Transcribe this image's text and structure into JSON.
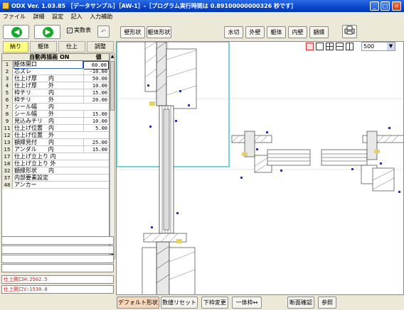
{
  "window": {
    "title": "ODX Ver. 1.03.85 ［データサンプル］［AW-1］-［プログラム実行時間は 0.89100000000326 秒です］",
    "minimize": "_",
    "maximize": "□",
    "close": "×"
  },
  "menu": [
    "ファイル",
    "詳細",
    "設定",
    "記入",
    "入力補助"
  ],
  "toolbar": {
    "back_icon": "arrow-left-icon",
    "forward_icon": "arrow-right-icon",
    "realsize_label": "実数表",
    "realsize_checked": true,
    "undo_icon": "undo-icon",
    "buttons": [
      "壁形状",
      "躯体形状",
      "水切",
      "外壁",
      "躯体",
      "内壁",
      "額縁"
    ],
    "print_icon": "print-icon"
  },
  "tabs": [
    "納り",
    "躯体",
    "仕上",
    "調整"
  ],
  "active_tab": "納り",
  "table": {
    "headers": [
      "自動再描画 ON",
      "値"
    ],
    "rows": [
      {
        "no": "1",
        "name": "躯体開口",
        "value": "60.00"
      },
      {
        "no": "2",
        "name": "芯ズレ",
        "value": "-10.00"
      },
      {
        "no": "3",
        "name": "仕上げ厚　　内",
        "value": "50.00"
      },
      {
        "no": "4",
        "name": "仕上げ厚　　外",
        "value": "10.00"
      },
      {
        "no": "5",
        "name": "枠チリ　　　内",
        "value": "15.00"
      },
      {
        "no": "6",
        "name": "枠チリ　　　外",
        "value": "20.00"
      },
      {
        "no": "7",
        "name": "シール幅　　内",
        "value": ""
      },
      {
        "no": "8",
        "name": "シール幅　　外",
        "value": "15.00"
      },
      {
        "no": "9",
        "name": "見込みチリ　内",
        "value": "10.00"
      },
      {
        "no": "11",
        "name": "仕上げ位置　内",
        "value": "5.00"
      },
      {
        "no": "12",
        "name": "仕上げ位置　外",
        "value": ""
      },
      {
        "no": "13",
        "name": "額縁見付　　内",
        "value": "25.00"
      },
      {
        "no": "15",
        "name": "アンダル　　内",
        "value": "15.00"
      },
      {
        "no": "17",
        "name": "仕上げ立上り 内",
        "value": ""
      },
      {
        "no": "18",
        "name": "仕上げ立上り 外",
        "value": ""
      },
      {
        "no": "32",
        "name": "額縁形状　　内",
        "value": ""
      },
      {
        "no": "37",
        "name": "内部要素設定",
        "value": ""
      },
      {
        "no": "48",
        "name": "アンカー",
        "value": ""
      }
    ]
  },
  "status_text": {
    "h_opening": "仕上開口H:2502.5",
    "v_opening": "仕上開口V:1530.0"
  },
  "view": {
    "zoom": "500"
  },
  "bottom_buttons": [
    "デフォルト形状",
    "数値リセット",
    "下枠変更",
    "一体枠↔",
    "断面確認",
    "参照"
  ]
}
